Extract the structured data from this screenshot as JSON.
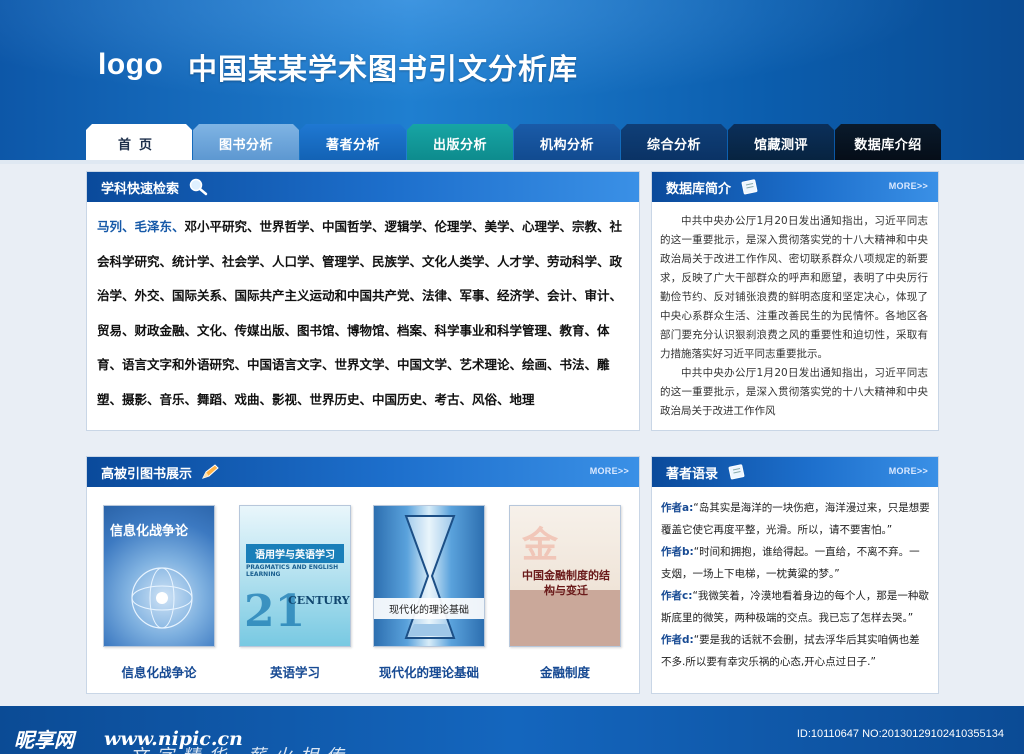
{
  "header": {
    "logo": "logo",
    "title": "中国某某学术图书引文分析库"
  },
  "nav": {
    "tabs": [
      {
        "label": "首页"
      },
      {
        "label": "图书分析"
      },
      {
        "label": "著者分析"
      },
      {
        "label": "出版分析"
      },
      {
        "label": "机构分析"
      },
      {
        "label": "综合分析"
      },
      {
        "label": "馆藏测评"
      },
      {
        "label": "数据库介绍"
      }
    ]
  },
  "subjects": {
    "title": "学科快速检索",
    "icon": "magnifier-icon",
    "highlight": "马列、毛泽东、",
    "text": "邓小平研究、世界哲学、中国哲学、逻辑学、伦理学、美学、心理学、宗教、社会科学研究、统计学、社会学、人口学、管理学、民族学、文化人类学、人才学、劳动科学、政治学、外交、国际关系、国际共产主义运动和中国共产党、法律、军事、经济学、会计、审计、贸易、财政金融、文化、传媒出版、图书馆、博物馆、档案、科学事业和科学管理、教育、体育、语言文字和外语研究、中国语言文字、世界文学、中国文学、艺术理论、绘画、书法、雕塑、摄影、音乐、舞蹈、戏曲、影视、世界历史、中国历史、考古、风俗、地理"
  },
  "intro": {
    "title": "数据库简介",
    "more": "MORE>>",
    "para1": "中共中央办公厅1月20日发出通知指出，习近平同志的这一重要批示，是深入贯彻落实党的十八大精神和中央政治局关于改进工作作风、密切联系群众八项规定的新要求，反映了广大干部群众的呼声和愿望，表明了中央厉行勤俭节约、反对铺张浪费的鲜明态度和坚定决心，体现了中央心系群众生活、注重改善民生的为民情怀。各地区各部门要充分认识狠刹浪费之风的重要性和迫切性，采取有力措施落实好习近平同志重要批示。",
    "para2": "中共中央办公厅1月20日发出通知指出，习近平同志的这一重要批示，是深入贯彻落实党的十八大精神和中央政治局关于改进工作作风"
  },
  "books": {
    "title": "高被引图书展示",
    "more": "MORE>>",
    "items": [
      {
        "caption": "信息化战争论",
        "cover_title": "信息化战争论"
      },
      {
        "caption": "英语学习",
        "cover_title": "语用学与英语学习",
        "cover_sub": "PRAGMATICS AND ENGLISH LEARNING",
        "cover_century": "CENTURY"
      },
      {
        "caption": "现代化的理论基础",
        "cover_title": "现代化的理论基础"
      },
      {
        "caption": "金融制度",
        "cover_title": "中国金融制度的结构与变迁"
      }
    ]
  },
  "quotes": {
    "title": "著者语录",
    "more": "MORE>>",
    "items": [
      {
        "who": "作者a:",
        "text": "“岛其实是海洋的一块伤疤，海洋漫过来，只是想要覆盖它使它再度平整，光滑。所以，请不要害怕。”"
      },
      {
        "who": "作者b:",
        "text": "“时间和拥抱，谁给得起。一直给，不离不弃。一支烟，一场上下电梯，一枕黄粱的梦。”"
      },
      {
        "who": "作者c:",
        "text": "“我微笑着，冷漠地看着身边的每个人，那是一种歇斯底里的微笑，两种极端的交点。我已忘了怎样去哭。”"
      },
      {
        "who": "作者d:",
        "text": "“要是我的话就不会删，拭去浮华后其实咱俩也差不多.所以要有幸灾乐祸的心态,开心点过日子.”"
      }
    ]
  },
  "footer": {
    "mark": "昵享网",
    "url": "www.nipic.cn",
    "slogan": "文字精华 薪火相传",
    "id": "ID:10110647 NO:20130129102410355134"
  }
}
